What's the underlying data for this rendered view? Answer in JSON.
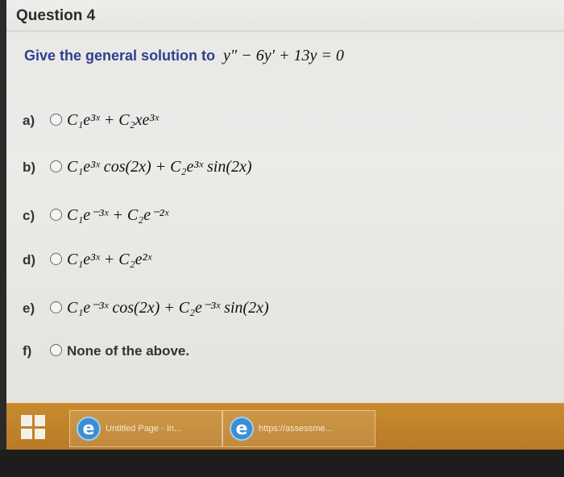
{
  "question": {
    "title": "Question 4",
    "prompt": "Give the general solution to",
    "equation": "y″ − 6y′ + 13y = 0"
  },
  "options": [
    {
      "letter": "a)",
      "expr": "C₁e³ˣ + C₂xe³ˣ"
    },
    {
      "letter": "b)",
      "expr": "C₁e³ˣ cos(2x) + C₂e³ˣ sin(2x)"
    },
    {
      "letter": "c)",
      "expr": "C₁e⁻³ˣ + C₂e⁻²ˣ"
    },
    {
      "letter": "d)",
      "expr": "C₁e³ˣ + C₂e²ˣ"
    },
    {
      "letter": "e)",
      "expr": "C₁e⁻³ˣ cos(2x) + C₂e⁻³ˣ sin(2x)"
    },
    {
      "letter": "f)",
      "text": "None of the above."
    }
  ],
  "taskbar": {
    "items": [
      {
        "label": "Untitled Page - In...",
        "icon": "internet-explorer-icon"
      },
      {
        "label": "https://assessme...",
        "icon": "internet-explorer-icon"
      }
    ],
    "accent": "#c98a2e"
  }
}
